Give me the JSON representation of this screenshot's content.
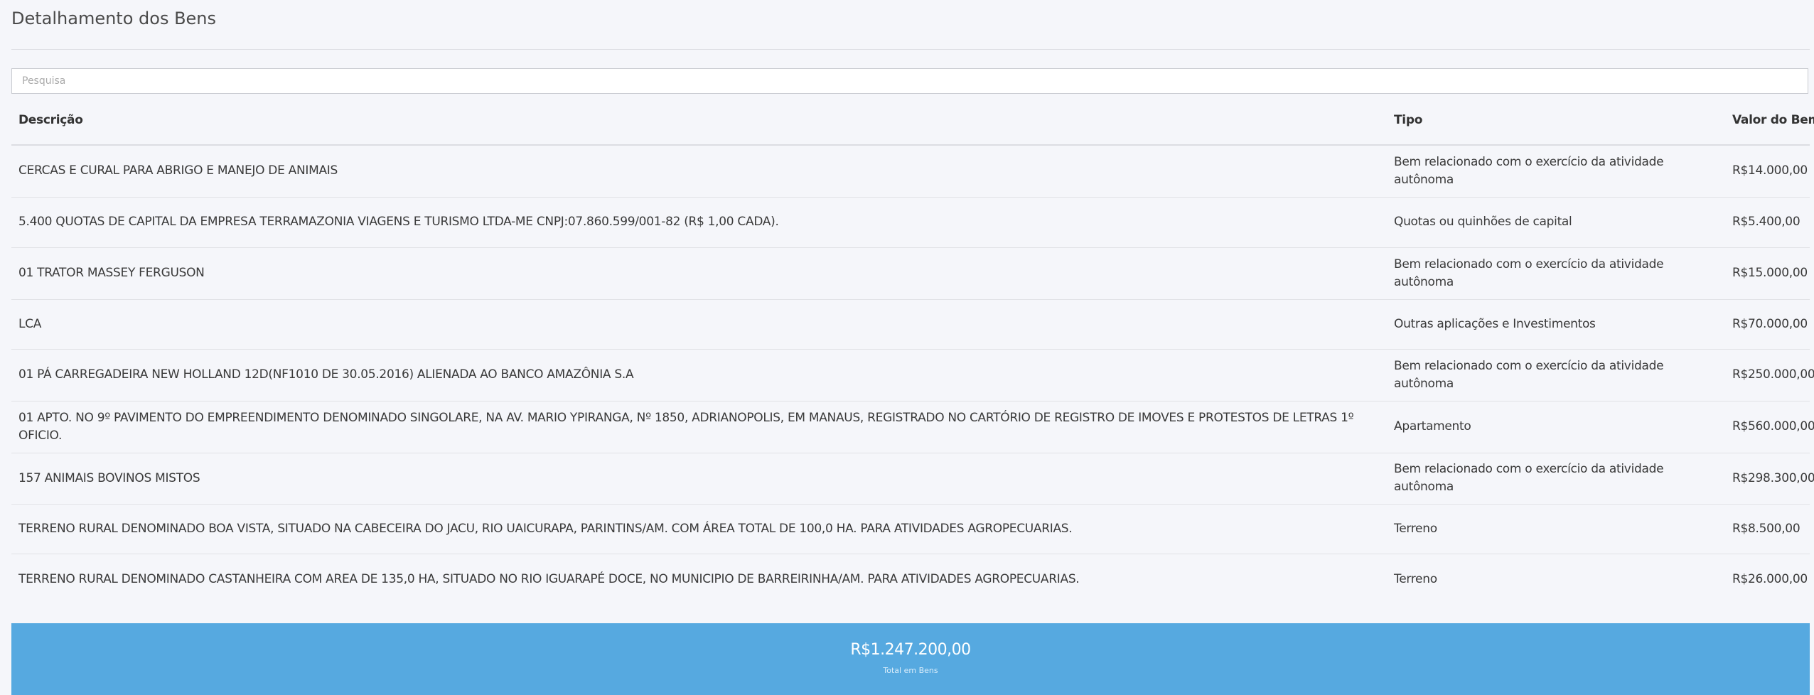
{
  "panel": {
    "title": "Detalhamento dos Bens"
  },
  "search": {
    "placeholder": "Pesquisa",
    "value": ""
  },
  "table": {
    "headers": {
      "descricao": "Descrição",
      "tipo": "Tipo",
      "valor": "Valor do Bem"
    },
    "rows": [
      {
        "descricao": "CERCAS E CURAL PARA ABRIGO E MANEJO DE ANIMAIS",
        "tipo": "Bem relacionado com o exercício da atividade autônoma",
        "valor": "R$14.000,00"
      },
      {
        "descricao": "5.400 QUOTAS DE CAPITAL DA EMPRESA TERRAMAZONIA VIAGENS E TURISMO LTDA-ME CNPJ:07.860.599/001-82 (R$ 1,00 CADA).",
        "tipo": "Quotas ou quinhões de capital",
        "valor": "R$5.400,00"
      },
      {
        "descricao": "01 TRATOR MASSEY FERGUSON",
        "tipo": "Bem relacionado com o exercício da atividade autônoma",
        "valor": "R$15.000,00"
      },
      {
        "descricao": "LCA",
        "tipo": "Outras aplicações e Investimentos",
        "valor": "R$70.000,00"
      },
      {
        "descricao": "01 PÁ CARREGADEIRA NEW HOLLAND 12D(NF1010 DE 30.05.2016) ALIENADA AO BANCO AMAZÔNIA S.A",
        "tipo": "Bem relacionado com o exercício da atividade autônoma",
        "valor": "R$250.000,00"
      },
      {
        "descricao": "01 APTO. NO 9º PAVIMENTO DO EMPREENDIMENTO DENOMINADO SINGOLARE, NA AV. MARIO YPIRANGA, Nº 1850, ADRIANOPOLIS, EM MANAUS, REGISTRADO NO CARTÓRIO DE REGISTRO DE IMOVES E PROTESTOS DE LETRAS 1º OFICIO.",
        "tipo": "Apartamento",
        "valor": "R$560.000,00"
      },
      {
        "descricao": "157 ANIMAIS BOVINOS MISTOS",
        "tipo": "Bem relacionado com o exercício da atividade autônoma",
        "valor": "R$298.300,00"
      },
      {
        "descricao": "TERRENO RURAL DENOMINADO BOA VISTA, SITUADO NA CABECEIRA DO JACU, RIO UAICURAPA, PARINTINS/AM. COM ÁREA TOTAL DE 100,0 HA. PARA ATIVIDADES AGROPECUARIAS.",
        "tipo": "Terreno",
        "valor": "R$8.500,00"
      },
      {
        "descricao": "TERRENO RURAL DENOMINADO CASTANHEIRA COM AREA DE 135,0 HA, SITUADO NO RIO IGUARAPÉ DOCE, NO MUNICIPIO DE BARREIRINHA/AM. PARA ATIVIDADES AGROPECUARIAS.",
        "tipo": "Terreno",
        "valor": "R$26.000,00"
      }
    ]
  },
  "total": {
    "value": "R$1.247.200,00",
    "label": "Total em Bens"
  },
  "colors": {
    "background": "#f5f6fa",
    "total_box": "#56a9e0",
    "divider": "#dcdde2"
  }
}
